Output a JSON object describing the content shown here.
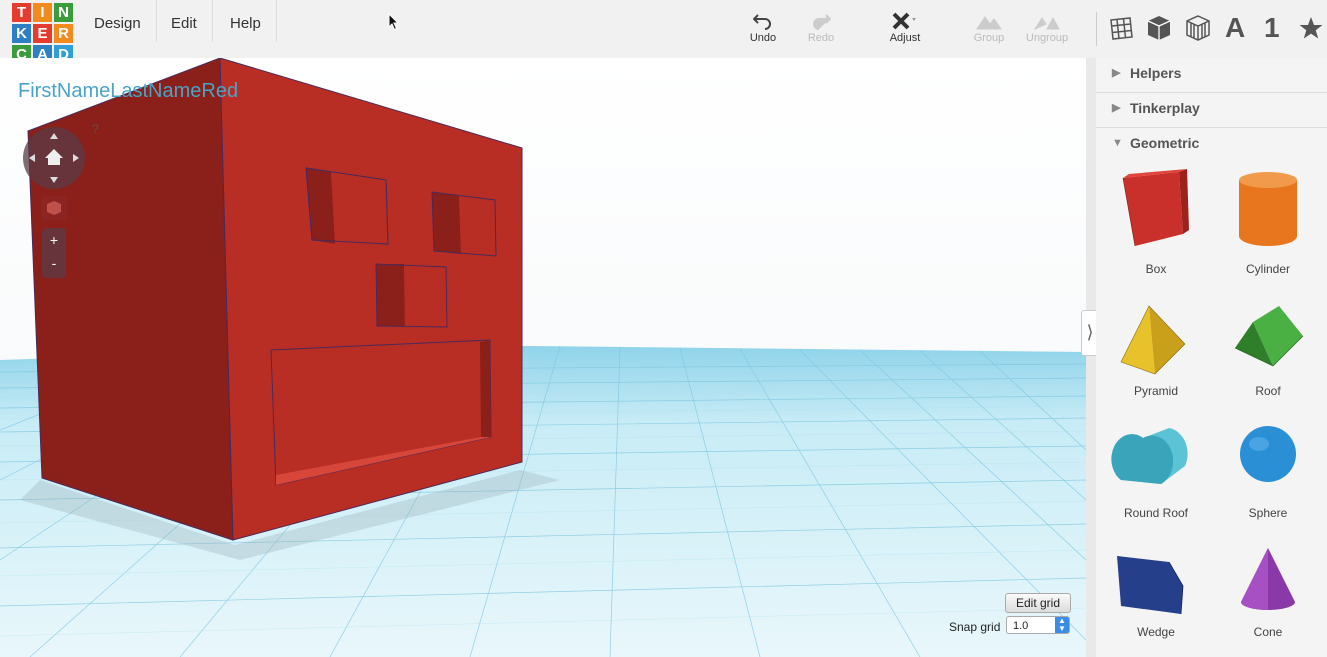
{
  "app": {
    "logo_letters": [
      "T",
      "I",
      "N",
      "K",
      "E",
      "R",
      "C",
      "A",
      "D"
    ],
    "logo_colors": [
      "#e53c2e",
      "#f28b1e",
      "#3a9c3c",
      "#2f7fc4",
      "#e53c2e",
      "#f28b1e",
      "#3a9c3c",
      "#2f7fc4",
      "#2f9fd7"
    ]
  },
  "menu": {
    "design": "Design",
    "edit": "Edit",
    "help": "Help"
  },
  "toolbar": {
    "undo": "Undo",
    "redo": "Redo",
    "adjust": "Adjust",
    "group": "Group",
    "ungroup": "Ungroup"
  },
  "view_icons": {
    "letter": "A",
    "number": "1"
  },
  "design_name": "FirstNameLastNameRed",
  "nav": {
    "help_mark": "?",
    "zoom_in": "+",
    "zoom_out": "-"
  },
  "sidebar": {
    "sections": [
      {
        "label": "Helpers",
        "expanded": false
      },
      {
        "label": "Tinkerplay",
        "expanded": false
      },
      {
        "label": "Geometric",
        "expanded": true
      }
    ],
    "shapes": [
      {
        "label": "Box",
        "color": "#c9302c"
      },
      {
        "label": "Cylinder",
        "color": "#e8761f"
      },
      {
        "label": "Pyramid",
        "color": "#e8c22a"
      },
      {
        "label": "Roof",
        "color": "#3fa63a"
      },
      {
        "label": "Round Roof",
        "color": "#5cc3d6"
      },
      {
        "label": "Sphere",
        "color": "#2b8fd6"
      },
      {
        "label": "Wedge",
        "color": "#263f8a"
      },
      {
        "label": "Cone",
        "color": "#8a3aa8"
      }
    ]
  },
  "grid_controls": {
    "edit_grid": "Edit grid",
    "snap_label": "Snap grid",
    "snap_value": "1.0"
  }
}
